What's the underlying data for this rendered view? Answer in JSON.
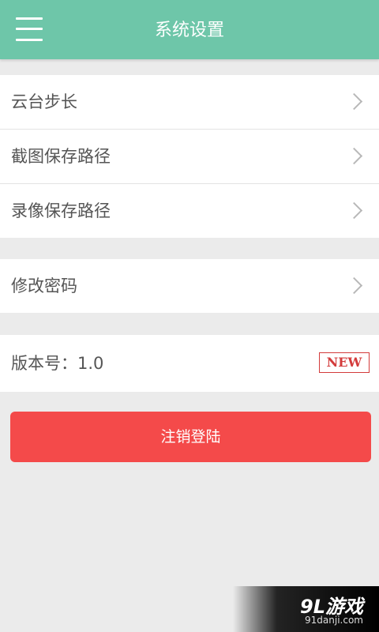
{
  "header": {
    "title": "系统设置",
    "menu_icon": "hamburger-menu-icon",
    "background_color": "#6ec6a9"
  },
  "settings_group_1": {
    "items": [
      {
        "label": "云台步长",
        "icon": "chevron-right-icon"
      },
      {
        "label": "截图保存路径",
        "icon": "chevron-right-icon"
      },
      {
        "label": "录像保存路径",
        "icon": "chevron-right-icon"
      }
    ]
  },
  "settings_group_2": {
    "items": [
      {
        "label": "修改密码",
        "icon": "chevron-right-icon"
      }
    ]
  },
  "version": {
    "label": "版本号：1.0",
    "badge": "NEW",
    "badge_color": "#d33b3b"
  },
  "logout_button": {
    "label": "注销登陆",
    "color": "#f44a4a"
  },
  "watermark": {
    "logo": "9L游戏",
    "url": "91danji.com"
  }
}
